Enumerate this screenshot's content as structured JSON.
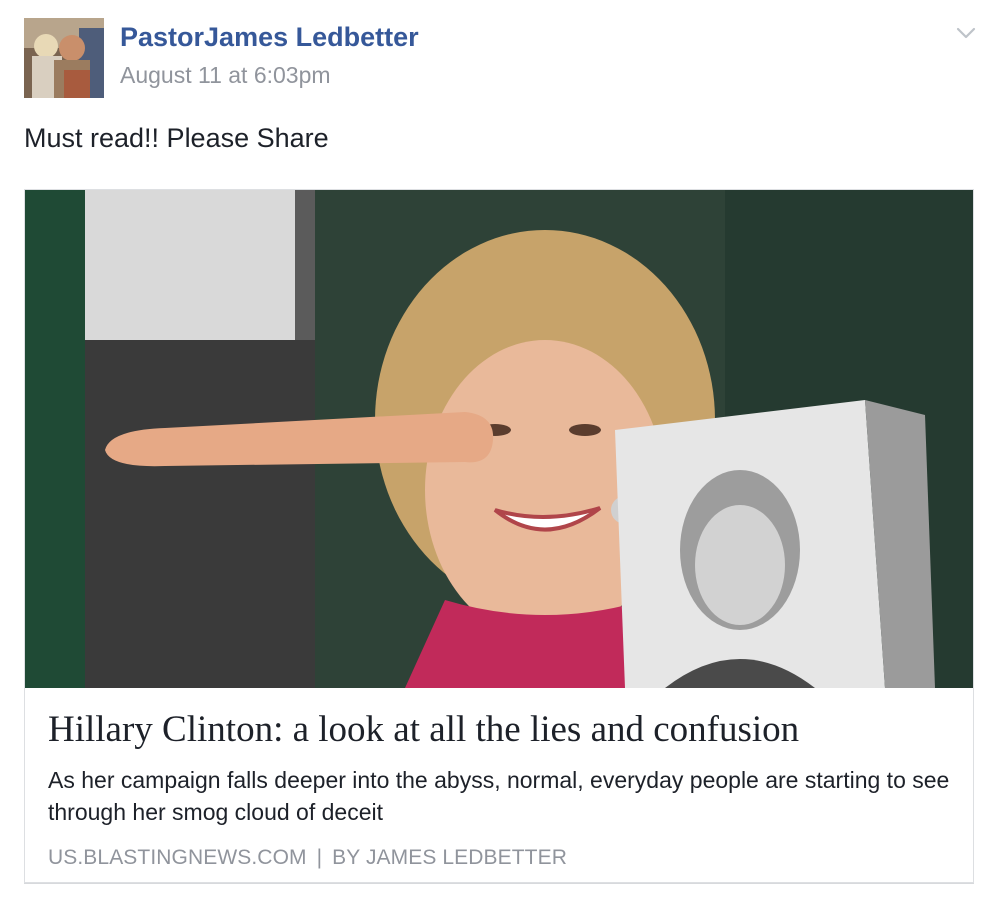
{
  "post": {
    "author_name": "PastorJames Ledbetter",
    "timestamp": "August 11 at 6:03pm",
    "message": "Must read!! Please Share",
    "options_icon": "chevron-down-icon",
    "avatar_icon": "profile-photo"
  },
  "link_preview": {
    "image_description_icon": "article-photo",
    "title": "Hillary Clinton: a look at all the lies and confusion",
    "description": "As her campaign falls deeper into the abyss, normal, everyday people are starting to see through her smog cloud of deceit",
    "domain": "US.BLASTINGNEWS.COM",
    "separator": "|",
    "byline": "BY JAMES LEDBETTER"
  },
  "colors": {
    "author_link": "#365899",
    "meta_gray": "#90949c",
    "text": "#1d2129",
    "border": "#dddfe2"
  }
}
